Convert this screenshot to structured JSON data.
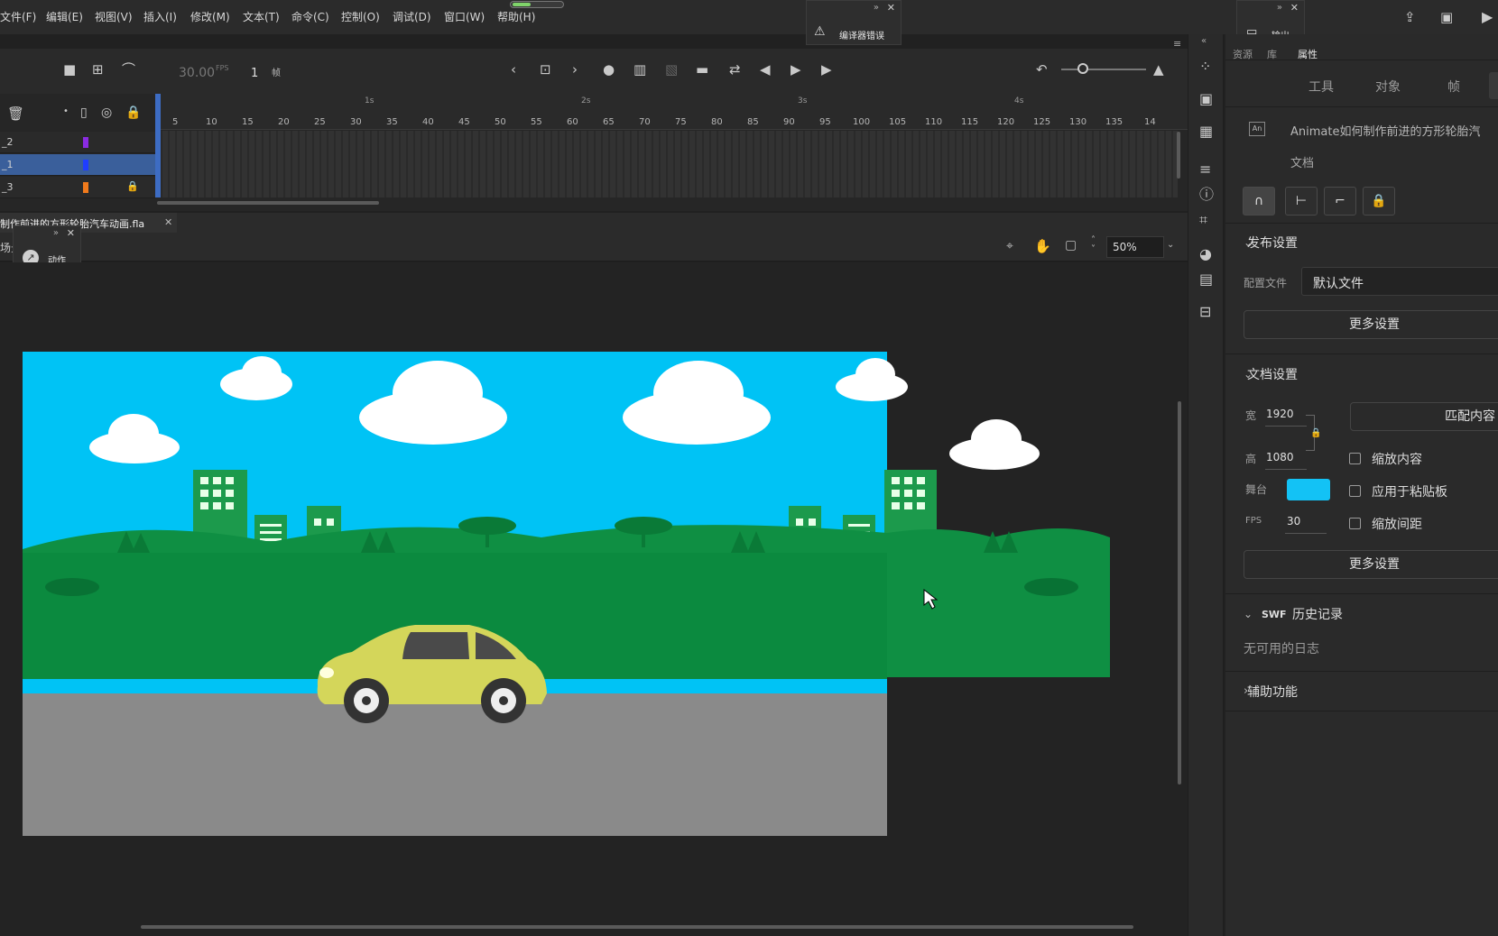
{
  "menu": [
    "文件(F)",
    "编辑(E)",
    "视图(V)",
    "插入(I)",
    "修改(M)",
    "文本(T)",
    "命令(C)",
    "控制(O)",
    "调试(D)",
    "窗口(W)",
    "帮助(H)"
  ],
  "floating_panels": {
    "compiler_errors": "编译器错误",
    "output": "输出",
    "actions": "动作"
  },
  "timeline": {
    "fps": "30.00",
    "fps_unit": "FPS",
    "current_frame": "1",
    "frame_unit": "帧",
    "seconds": [
      "1s",
      "2s",
      "3s",
      "4s"
    ],
    "ticks": [
      "5",
      "10",
      "15",
      "20",
      "25",
      "30",
      "35",
      "40",
      "45",
      "50",
      "55",
      "60",
      "65",
      "70",
      "75",
      "80",
      "85",
      "90",
      "95",
      "100",
      "105",
      "110",
      "115",
      "120",
      "125",
      "130",
      "135",
      "14"
    ],
    "layers": [
      {
        "name": "_2",
        "color": "#8a2be2",
        "selected": false,
        "locked": false
      },
      {
        "name": "_1",
        "color": "#1f3dff",
        "selected": true,
        "locked": false
      },
      {
        "name": "_3",
        "color": "#f07a1c",
        "selected": false,
        "locked": true
      }
    ]
  },
  "document": {
    "tab_title": "制作前进的方形轮胎汽车动画.fla",
    "scene_label": "场景",
    "zoom": "50%"
  },
  "right_panel": {
    "top_tabs": [
      "资源",
      "库",
      "属性"
    ],
    "active_top_tab": "属性",
    "sub_tabs": [
      "工具",
      "对象",
      "帧"
    ],
    "doc_name": "Animate如何制作前进的方形轮胎汽",
    "doc_type": "文档",
    "publish": {
      "header": "发布设置",
      "profile_label": "配置文件",
      "profile_value": "默认文件",
      "more_settings": "更多设置"
    },
    "doc_settings": {
      "header": "文档设置",
      "width_label": "宽",
      "width": "1920",
      "height_label": "高",
      "height": "1080",
      "match_contents": "匹配内容",
      "scale_content": "缩放内容",
      "stage_label": "舞台",
      "stage_color": "#13c2f5",
      "apply_pasteboard": "应用于粘贴板",
      "fps_label": "FPS",
      "fps": "30",
      "scale_spans": "缩放间距",
      "more_settings": "更多设置"
    },
    "swf_history": {
      "prefix": "SWF",
      "header": "历史记录",
      "empty": "无可用的日志"
    },
    "accessibility": "辅助功能"
  },
  "colors": {
    "sky": "#00c3f5",
    "ground": "#8a8a8a",
    "grass": "#0f8f43",
    "building": "#1c9a4c",
    "car": "#d4d65a"
  }
}
